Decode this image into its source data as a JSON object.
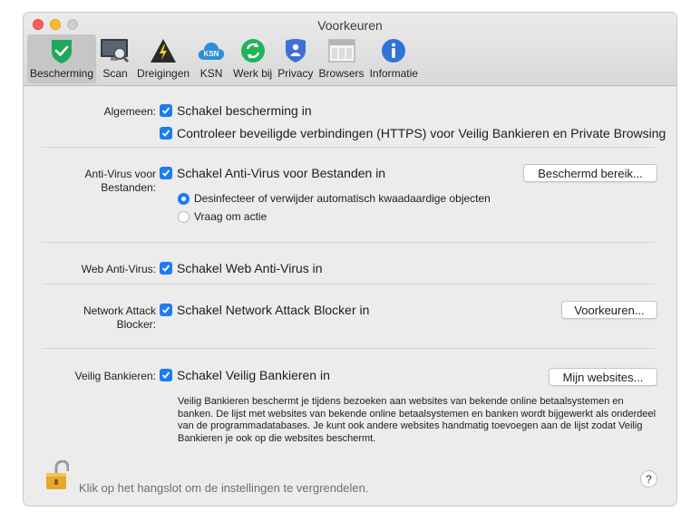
{
  "window": {
    "title": "Voorkeuren"
  },
  "toolbar": {
    "items": [
      {
        "label": "Bescherming",
        "icon": "shield-check-icon",
        "active": true
      },
      {
        "label": "Scan",
        "icon": "scan-monitor-icon"
      },
      {
        "label": "Dreigingen",
        "icon": "threat-warning-icon"
      },
      {
        "label": "KSN",
        "icon": "ksn-cloud-icon"
      },
      {
        "label": "Werk bij",
        "icon": "update-refresh-icon"
      },
      {
        "label": "Privacy",
        "icon": "privacy-shield-icon"
      },
      {
        "label": "Browsers",
        "icon": "browsers-window-icon"
      },
      {
        "label": "Informatie",
        "icon": "info-icon"
      }
    ]
  },
  "sections": {
    "algemeen": {
      "label": "Algemeen:",
      "option1": "Schakel bescherming in",
      "option2": "Controleer beveiligde verbindingen (HTTPS) voor Veilig Bankieren en Private Browsing"
    },
    "antivirus": {
      "label_line1": "Anti-Virus voor",
      "label_line2": "Bestanden:",
      "option": "Schakel Anti-Virus voor Bestanden in",
      "button": "Beschermd bereik...",
      "radio1": "Desinfecteer of verwijder automatisch kwaadaardige objecten",
      "radio2": "Vraag om actie"
    },
    "web": {
      "label": "Web Anti-Virus:",
      "option": "Schakel Web Anti-Virus in"
    },
    "network": {
      "label_line1": "Network Attack",
      "label_line2": "Blocker:",
      "option": "Schakel Network Attack Blocker in",
      "button": "Voorkeuren..."
    },
    "banking": {
      "label": "Veilig Bankieren:",
      "option": "Schakel Veilig Bankieren in",
      "button": "Mijn websites...",
      "description": "Veilig Bankieren beschermt je tijdens bezoeken aan websites van bekende online betaalsystemen en banken. De lijst met websites van bekende online betaalsystemen en banken wordt bijgewerkt als onderdeel van de programmadatabases. Je kunt ook andere websites handmatig toevoegen aan de lijst zodat Veilig Bankieren je ook op die websites beschermt."
    }
  },
  "footer": {
    "lock_text": "Klik op het hangslot om de instellingen te vergrendelen.",
    "help": "?"
  },
  "colors": {
    "accent": "#1b7cf4",
    "shield_green": "#1fa85a",
    "ksn_blue": "#2d8fd6"
  }
}
